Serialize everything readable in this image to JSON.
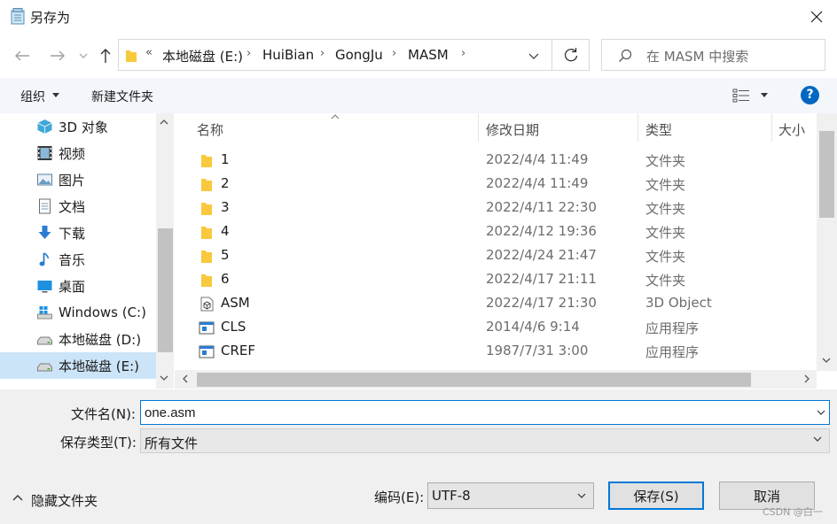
{
  "window": {
    "title": "另存为"
  },
  "address": {
    "overflow": "«",
    "crumbs": [
      "本地磁盘 (E:)",
      "HuiBian",
      "GongJu",
      "MASM"
    ]
  },
  "search": {
    "placeholder": "在 MASM 中搜索"
  },
  "toolbar": {
    "organize": "组织",
    "new_folder": "新建文件夹",
    "help": "?"
  },
  "nav": {
    "items": [
      {
        "label": "3D 对象",
        "icon": "3d-objects-icon"
      },
      {
        "label": "视频",
        "icon": "video-icon"
      },
      {
        "label": "图片",
        "icon": "pictures-icon"
      },
      {
        "label": "文档",
        "icon": "documents-icon"
      },
      {
        "label": "下载",
        "icon": "download-icon"
      },
      {
        "label": "音乐",
        "icon": "music-icon"
      },
      {
        "label": "桌面",
        "icon": "desktop-icon"
      },
      {
        "label": "Windows (C:)",
        "icon": "windows-drive-icon"
      },
      {
        "label": "本地磁盘 (D:)",
        "icon": "drive-icon"
      },
      {
        "label": "本地磁盘 (E:)",
        "icon": "drive-icon"
      }
    ],
    "selected_index": 9
  },
  "columns": {
    "name": "名称",
    "date": "修改日期",
    "type": "类型",
    "size": "大小"
  },
  "files": [
    {
      "name": "1",
      "date": "2022/4/4 11:49",
      "type": "文件夹",
      "icon": "folder-icon"
    },
    {
      "name": "2",
      "date": "2022/4/4 11:49",
      "type": "文件夹",
      "icon": "folder-icon"
    },
    {
      "name": "3",
      "date": "2022/4/11 22:30",
      "type": "文件夹",
      "icon": "folder-icon"
    },
    {
      "name": "4",
      "date": "2022/4/12 19:36",
      "type": "文件夹",
      "icon": "folder-icon"
    },
    {
      "name": "5",
      "date": "2022/4/24 21:47",
      "type": "文件夹",
      "icon": "folder-icon"
    },
    {
      "name": "6",
      "date": "2022/4/17 21:11",
      "type": "文件夹",
      "icon": "folder-icon"
    },
    {
      "name": "ASM",
      "date": "2022/4/17 21:30",
      "type": "3D Object",
      "icon": "3d-file-icon"
    },
    {
      "name": "CLS",
      "date": "2014/4/6 9:14",
      "type": "应用程序",
      "icon": "app-icon"
    },
    {
      "name": "CREF",
      "date": "1987/7/31 3:00",
      "type": "应用程序",
      "icon": "app-icon"
    }
  ],
  "form": {
    "filename_label": "文件名(N):",
    "filename_value": "one.asm",
    "filetype_label": "保存类型(T):",
    "filetype_value": "所有文件",
    "hide_folders": "隐藏文件夹",
    "encoding_label": "编码(E):",
    "encoding_value": "UTF-8",
    "save": "保存(S)",
    "cancel": "取消"
  },
  "watermark": "CSDN @白一",
  "colors": {
    "accent": "#0078d7",
    "selected": "#cce4f7",
    "folder": "#f8c93e",
    "help": "#0067c0"
  }
}
